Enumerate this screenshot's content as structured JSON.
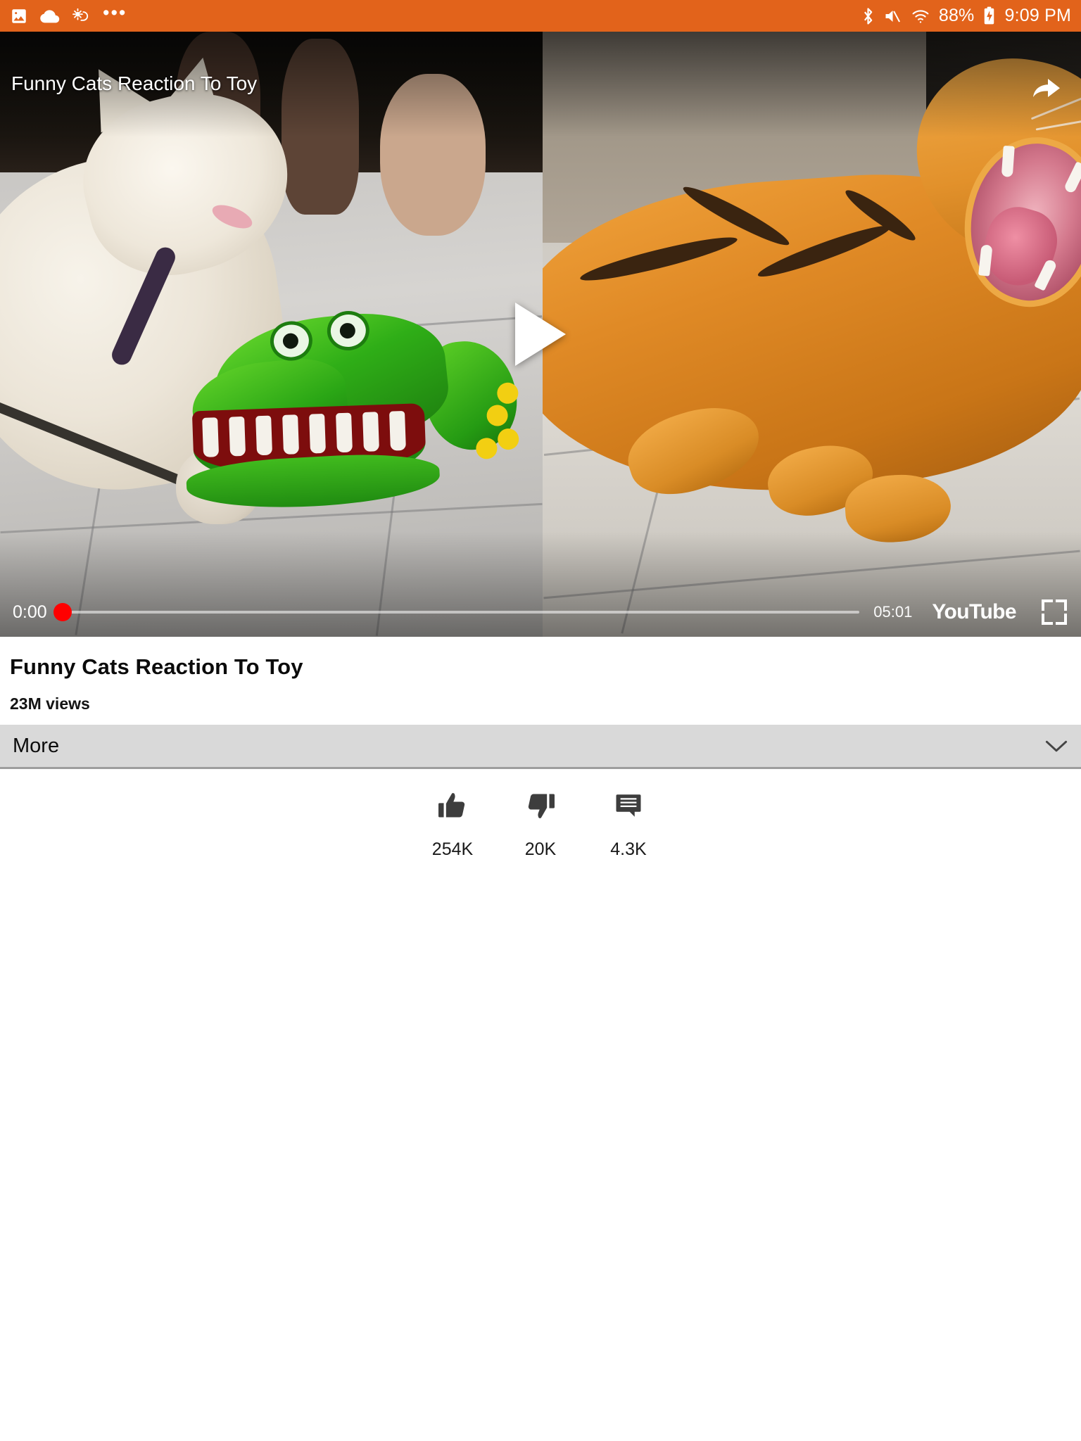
{
  "status_bar": {
    "background_color": "#E2631B",
    "left_icons": [
      "image-icon",
      "cloud-icon",
      "weather-partly-sunny-icon",
      "more-dots-icon"
    ],
    "right_icons": [
      "bluetooth-icon",
      "volume-mute-icon",
      "wifi-icon"
    ],
    "battery_percent": "88%",
    "battery_icon": "battery-charging-icon",
    "time": "9:09 PM"
  },
  "player": {
    "overlay_title": "Funny Cats Reaction To Toy",
    "share_icon": "share-arrow-icon",
    "play_icon": "play-triangle-icon",
    "current_time": "0:00",
    "duration": "05:01",
    "progress_percent": 0,
    "scrubber_color": "#ff0000",
    "brand": "YouTube",
    "fullscreen_icon": "fullscreen-icon"
  },
  "meta": {
    "title": "Funny Cats Reaction To Toy",
    "views": "23M views"
  },
  "more_section": {
    "label": "More",
    "chevron_icon": "chevron-down-icon",
    "background_color": "#d9d9d9"
  },
  "actions": [
    {
      "name": "like",
      "icon": "thumbs-up-icon",
      "count": "254K"
    },
    {
      "name": "dislike",
      "icon": "thumbs-down-icon",
      "count": "20K"
    },
    {
      "name": "comments",
      "icon": "comment-bubble-icon",
      "count": "4.3K"
    }
  ]
}
